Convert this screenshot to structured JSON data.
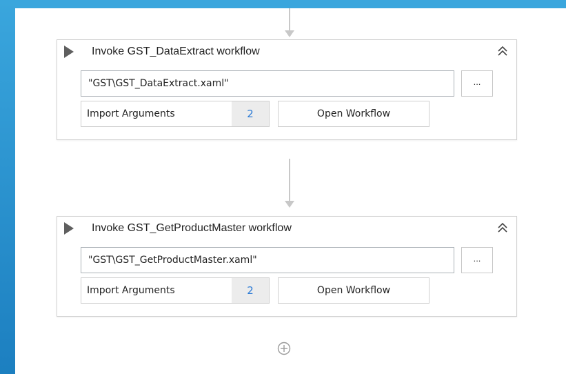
{
  "activities": [
    {
      "title": "Invoke GST_DataExtract workflow",
      "path": "\"GST\\GST_DataExtract.xaml\"",
      "browse_label": "...",
      "import_label": "Import Arguments",
      "import_count": "2",
      "open_label": "Open Workflow"
    },
    {
      "title": "Invoke GST_GetProductMaster workflow",
      "path": "\"GST\\GST_GetProductMaster.xaml\"",
      "browse_label": "...",
      "import_label": "Import Arguments",
      "import_count": "2",
      "open_label": "Open Workflow"
    }
  ],
  "icons": {
    "run": "play-icon",
    "collapse": "double-chevron-up-icon",
    "add": "plus-circle-icon"
  },
  "colors": {
    "frame": "#2a9bd3",
    "count": "#2c7bd6"
  }
}
